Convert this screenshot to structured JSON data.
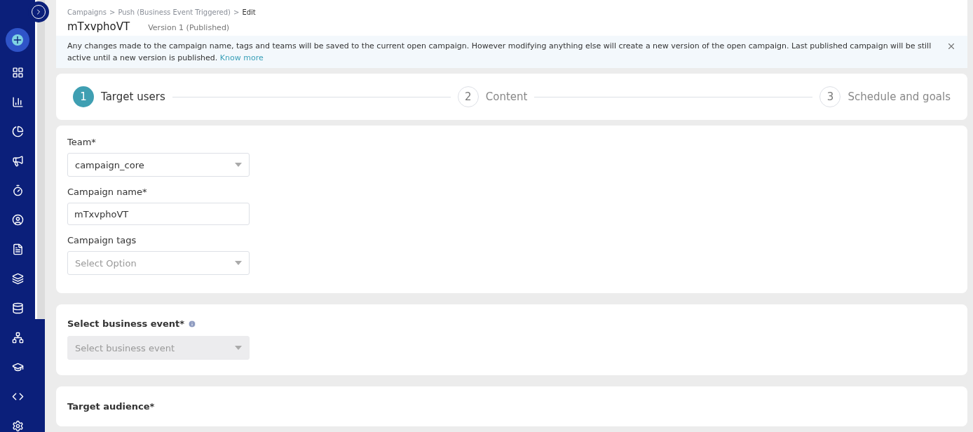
{
  "breadcrumb": [
    {
      "label": "Campaigns",
      "current": false
    },
    {
      "label": "Push (Business Event Triggered)",
      "current": false
    },
    {
      "label": "Edit",
      "current": true
    }
  ],
  "breadcrumb_separator": ">",
  "title": "mTxvphoVT",
  "version": "Version 1 (Published)",
  "notice": {
    "text": "Any changes made to the campaign name, tags and teams will be saved to the current open campaign. However modifying anything else will create a new version of the open campaign. Last published campaign will be still active until a new version is published.",
    "link": "Know more"
  },
  "steps": [
    {
      "number": "1",
      "label": "Target users",
      "selected": true
    },
    {
      "number": "2",
      "label": "Content",
      "selected": false
    },
    {
      "number": "3",
      "label": "Schedule and goals",
      "selected": false
    }
  ],
  "fields": [
    {
      "kind": "select",
      "label": "Team*",
      "value": "campaign_core"
    },
    {
      "kind": "input",
      "label": "Campaign name*",
      "value": "mTxvphoVT"
    },
    {
      "kind": "select",
      "label": "Campaign tags",
      "placeholder": "Select Option"
    }
  ],
  "business_event": {
    "label": "Select business event*",
    "placeholder": "Select business event",
    "disabled": true
  },
  "target_audience": {
    "label": "Target audience*"
  }
}
